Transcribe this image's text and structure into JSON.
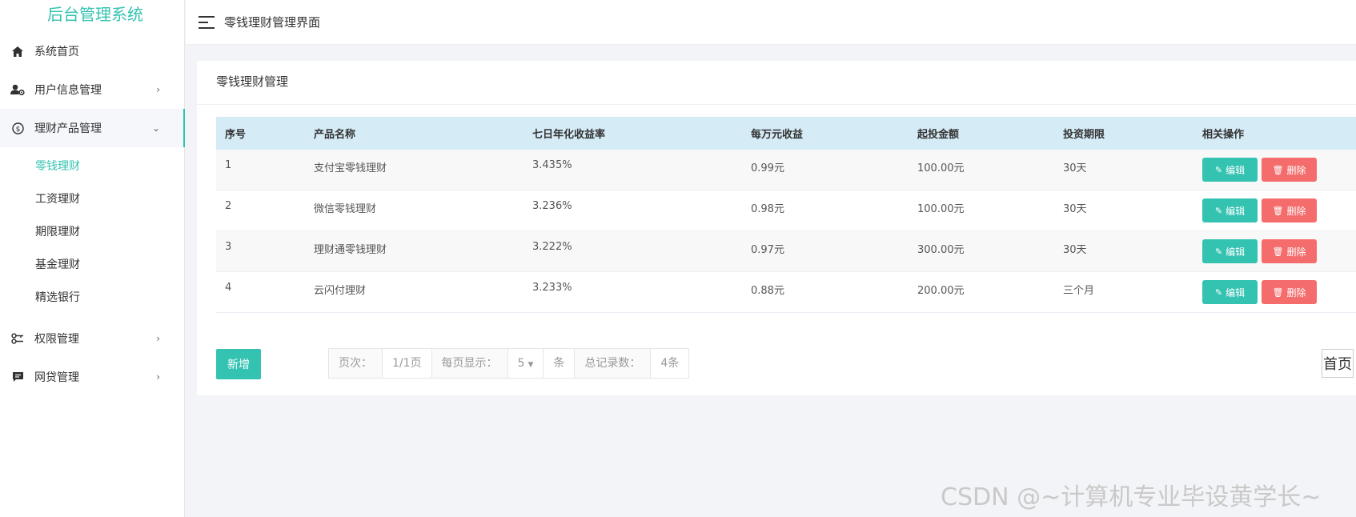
{
  "app": {
    "title": "后台管理系统"
  },
  "sidebar": {
    "items": [
      {
        "label": "系统首页",
        "icon": "home-icon"
      },
      {
        "label": "用户信息管理",
        "icon": "user-gear-icon",
        "arrow": "›"
      },
      {
        "label": "理财产品管理",
        "icon": "dollar-circle-icon",
        "arrow": "⌄",
        "children": [
          {
            "label": "零钱理财",
            "active": true
          },
          {
            "label": "工资理财"
          },
          {
            "label": "期限理财"
          },
          {
            "label": "基金理财"
          },
          {
            "label": "精选银行"
          }
        ]
      },
      {
        "label": "权限管理",
        "icon": "key-icon",
        "arrow": "›"
      },
      {
        "label": "网贷管理",
        "icon": "message-icon",
        "arrow": "›"
      }
    ]
  },
  "header": {
    "title": "零钱理财管理界面"
  },
  "panel": {
    "title": "零钱理财管理"
  },
  "table": {
    "columns": [
      "序号",
      "产品名称",
      "七日年化收益率",
      "每万元收益",
      "起投金额",
      "投资期限",
      "相关操作"
    ],
    "rows": [
      [
        "1",
        "支付宝零钱理财",
        "3.435%",
        "0.99元",
        "100.00元",
        "30天"
      ],
      [
        "2",
        "微信零钱理财",
        "3.236%",
        "0.98元",
        "100.00元",
        "30天"
      ],
      [
        "3",
        "理财通零钱理财",
        "3.222%",
        "0.97元",
        "300.00元",
        "30天"
      ],
      [
        "4",
        "云闪付理财",
        "3.233%",
        "0.88元",
        "200.00元",
        "三个月"
      ]
    ],
    "edit_label": "编辑",
    "delete_label": "删除"
  },
  "actions": {
    "add_label": "新增"
  },
  "pagination": {
    "page_label": "页次：",
    "page_value": "1/1页",
    "per_page_label": "每页显示：",
    "per_page_value": "5",
    "per_page_unit": "条",
    "total_label": "总记录数：",
    "total_value": "4条",
    "first_page": "首页"
  },
  "watermark": "CSDN @~计算机专业毕设黄学长~",
  "colors": {
    "accent": "#34c3b1",
    "danger": "#f46c6c",
    "table_header": "#d5ebf6"
  }
}
